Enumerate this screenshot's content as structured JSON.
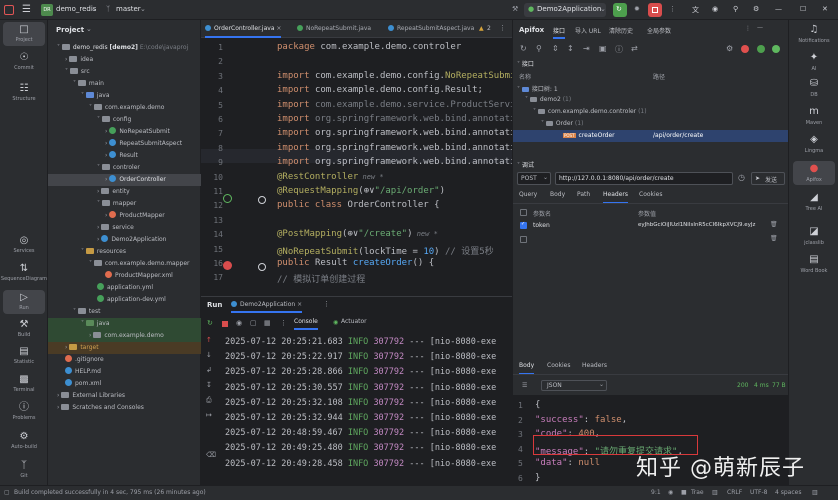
{
  "titlebar": {
    "project_badge": "DR",
    "project": "demo_redis",
    "branch": "master",
    "run_config": "Demo2Application"
  },
  "left_tools": [
    "Project",
    "Commit",
    "Structure",
    "Services",
    "SequenceDiagram",
    "Run",
    "Build",
    "Statistic",
    "Terminal",
    "Problems",
    "Auto-build",
    "Git"
  ],
  "project_panel": {
    "header": "Project",
    "root_name": "demo_redis",
    "root_module": "[demo2]",
    "root_path": "E:\\code\\javaproj",
    "items": [
      {
        "label": "idea"
      },
      {
        "label": "src"
      },
      {
        "label": "main"
      },
      {
        "label": "java"
      },
      {
        "label": "com.example.demo"
      },
      {
        "label": "config"
      },
      {
        "label": "NoRepeatSubmit"
      },
      {
        "label": "RepeatSubmitAspect"
      },
      {
        "label": "Result"
      },
      {
        "label": "controler"
      },
      {
        "label": "OrderController"
      },
      {
        "label": "entity"
      },
      {
        "label": "mapper"
      },
      {
        "label": "ProductMapper"
      },
      {
        "label": "service"
      },
      {
        "label": "Demo2Application"
      },
      {
        "label": "resources"
      },
      {
        "label": "com.example.demo.mapper"
      },
      {
        "label": "ProductMapper.xml"
      },
      {
        "label": "application.yml"
      },
      {
        "label": "application-dev.yml"
      },
      {
        "label": "test"
      },
      {
        "label": "java"
      },
      {
        "label": "com.example.demo"
      },
      {
        "label": "target"
      },
      {
        "label": ".gitignore"
      },
      {
        "label": "HELP.md"
      },
      {
        "label": "pom.xml"
      },
      {
        "label": "External Libraries"
      },
      {
        "label": "Scratches and Consoles"
      }
    ]
  },
  "editor": {
    "tabs": [
      "OrderController.java",
      "NoRepeatSubmit.java",
      "RepeatSubmitAspect.java"
    ],
    "warn_count": "2",
    "lines": [
      {
        "n": "1",
        "parts": [
          {
            "c": "kw",
            "t": "package "
          },
          {
            "c": "",
            "t": "com.example.demo.controler"
          }
        ]
      },
      {
        "n": "2",
        "parts": []
      },
      {
        "n": "3",
        "parts": [
          {
            "c": "kw",
            "t": "import "
          },
          {
            "c": "",
            "t": "com.example.demo.config."
          },
          {
            "c": "an",
            "t": "NoRepeatSubmit"
          }
        ]
      },
      {
        "n": "4",
        "parts": [
          {
            "c": "kw",
            "t": "import "
          },
          {
            "c": "",
            "t": "com.example.demo.config.Result;"
          }
        ]
      },
      {
        "n": "5",
        "parts": [
          {
            "c": "kw",
            "t": "import "
          },
          {
            "c": "dim",
            "t": "com.example.demo.service.ProductServic"
          }
        ]
      },
      {
        "n": "6",
        "parts": [
          {
            "c": "kw",
            "t": "import "
          },
          {
            "c": "dim",
            "t": "org.springframework.web.bind.annotatio"
          }
        ]
      },
      {
        "n": "7",
        "parts": [
          {
            "c": "kw",
            "t": "import "
          },
          {
            "c": "",
            "t": "org.springframework.web.bind.annotatio"
          }
        ]
      },
      {
        "n": "8",
        "parts": [
          {
            "c": "kw",
            "t": "import "
          },
          {
            "c": "",
            "t": "org.springframework.web.bind.annotatio"
          }
        ]
      },
      {
        "n": "9",
        "parts": [
          {
            "c": "kw",
            "t": "import "
          },
          {
            "c": "",
            "t": "org.springframework.web.bind.annotatio"
          }
        ]
      },
      {
        "n": "10",
        "parts": [
          {
            "c": "an",
            "t": "@RestController"
          },
          {
            "c": "hint",
            "t": "  new *"
          }
        ]
      },
      {
        "n": "11",
        "parts": [
          {
            "c": "an",
            "t": "@RequestMapping"
          },
          {
            "c": "",
            "t": "(⊕∨"
          },
          {
            "c": "st",
            "t": "\"/api/order\""
          },
          {
            "c": "",
            "t": ")"
          }
        ]
      },
      {
        "n": "12",
        "parts": [
          {
            "c": "kw",
            "t": "public class "
          },
          {
            "c": "",
            "t": "OrderController {"
          }
        ]
      },
      {
        "n": "13",
        "parts": []
      },
      {
        "n": "14",
        "parts": [
          {
            "c": "an",
            "t": "    @PostMapping"
          },
          {
            "c": "",
            "t": "(⊕∨"
          },
          {
            "c": "st",
            "t": "\"/create\""
          },
          {
            "c": "",
            "t": ")"
          },
          {
            "c": "hint",
            "t": "  new *"
          }
        ]
      },
      {
        "n": "15",
        "parts": [
          {
            "c": "an",
            "t": "    @NoRepeatSubmit"
          },
          {
            "c": "",
            "t": "(lockTime = "
          },
          {
            "c": "fn",
            "t": "10"
          },
          {
            "c": "",
            "t": ") "
          },
          {
            "c": "dim",
            "t": "// 设置5秒"
          }
        ]
      },
      {
        "n": "16",
        "parts": [
          {
            "c": "kw",
            "t": "    public "
          },
          {
            "c": "",
            "t": "Result "
          },
          {
            "c": "fn",
            "t": "createOrder"
          },
          {
            "c": "",
            "t": "() {"
          }
        ]
      },
      {
        "n": "17",
        "parts": [
          {
            "c": "dim",
            "t": "        // 模拟订单创建过程"
          }
        ]
      }
    ]
  },
  "run_panel": {
    "tab": "Run",
    "config_tab": "Demo2Application",
    "sub_tabs": [
      "Console",
      "Actuator"
    ],
    "logs": [
      {
        "ts": "2025-07-12 20:25:21.683",
        "lvl": "INFO",
        "pid": "307792",
        "thr": "--- [nio-8080-exe"
      },
      {
        "ts": "2025-07-12 20:25:22.917",
        "lvl": "INFO",
        "pid": "307792",
        "thr": "--- [nio-8080-exe"
      },
      {
        "ts": "2025-07-12 20:25:28.866",
        "lvl": "INFO",
        "pid": "307792",
        "thr": "--- [nio-8080-exe"
      },
      {
        "ts": "2025-07-12 20:25:30.557",
        "lvl": "INFO",
        "pid": "307792",
        "thr": "--- [nio-8080-exe"
      },
      {
        "ts": "2025-07-12 20:25:32.108",
        "lvl": "INFO",
        "pid": "307792",
        "thr": "--- [nio-8080-exe"
      },
      {
        "ts": "2025-07-12 20:25:32.944",
        "lvl": "INFO",
        "pid": "307792",
        "thr": "--- [nio-8080-exe"
      },
      {
        "ts": "2025-07-12 20:48:59.467",
        "lvl": "INFO",
        "pid": "307792",
        "thr": "--- [nio-8080-exe"
      },
      {
        "ts": "2025-07-12 20:49:25.480",
        "lvl": "INFO",
        "pid": "307792",
        "thr": "--- [nio-8080-exe"
      },
      {
        "ts": "2025-07-12 20:49:28.458",
        "lvl": "INFO",
        "pid": "307792",
        "thr": "--- [nio-8080-exe"
      }
    ]
  },
  "apifox": {
    "title": "Apifox",
    "nav_tabs": [
      "接口",
      "导入 URL",
      "清除历史",
      "全局参数"
    ],
    "section_api": "接口",
    "col_name": "名称",
    "col_path": "路径",
    "tree": {
      "n1": "接口树: 1",
      "n2": "demo2",
      "n2c": "(1)",
      "n3": "com.example.demo.controler",
      "n3c": "(1)",
      "n4": "Order",
      "n4c": "(1)",
      "n5": "createOrder",
      "n5path": "/api/order/create"
    },
    "section_debug": "调试",
    "method": "POST",
    "url": "http://127.0.0.1:8080/api/order/create",
    "send": "发送",
    "req_tabs": [
      "Query",
      "Body",
      "Path",
      "Headers",
      "Cookies"
    ],
    "param_name": "参数名",
    "param_value": "参数值",
    "param_row_name": "token",
    "param_row_value": "eyJhbGciOiJIUzI1NiIsInR5cCI6IkpXVCJ9.eyJz",
    "resp_tabs": [
      "Body",
      "Cookies",
      "Headers"
    ],
    "format": "JSON",
    "status_code": "200",
    "time": "4 ms",
    "size": "77 B",
    "json_lines": [
      {
        "n": "1",
        "parts": [
          {
            "c": "",
            "t": "{"
          }
        ]
      },
      {
        "n": "2",
        "parts": [
          {
            "c": "jk",
            "t": "  \"success\""
          },
          {
            "c": "",
            "t": ": "
          },
          {
            "c": "jv",
            "t": "false"
          },
          {
            "c": "",
            "t": ","
          }
        ]
      },
      {
        "n": "3",
        "parts": [
          {
            "c": "jk",
            "t": "  \"code\""
          },
          {
            "c": "",
            "t": ": "
          },
          {
            "c": "jv",
            "t": "400"
          },
          {
            "c": "",
            "t": ","
          }
        ]
      },
      {
        "n": "4",
        "parts": [
          {
            "c": "jk",
            "t": "  \"message\""
          },
          {
            "c": "",
            "t": ": "
          },
          {
            "c": "js",
            "t": "\"请勿重复提交请求\""
          },
          {
            "c": "",
            "t": ","
          }
        ]
      },
      {
        "n": "5",
        "parts": [
          {
            "c": "jk",
            "t": "  \"data\""
          },
          {
            "c": "",
            "t": ": "
          },
          {
            "c": "jv",
            "t": "null"
          }
        ]
      },
      {
        "n": "6",
        "parts": [
          {
            "c": "",
            "t": "}"
          }
        ]
      }
    ]
  },
  "right_tools": [
    "Notifications",
    "AI",
    "DB",
    "Maven",
    "Lingma",
    "Apifox",
    "Tree AI",
    "jclasslib",
    "Word Book"
  ],
  "watermark": "知乎 @萌新辰子",
  "statusbar": {
    "message": "Build completed successfully in 4 sec, 795 ms (26 minutes ago)",
    "position": "9:1",
    "trae": "Trae",
    "eol": "CRLF",
    "encoding": "UTF-8",
    "indent": "4 spaces"
  }
}
